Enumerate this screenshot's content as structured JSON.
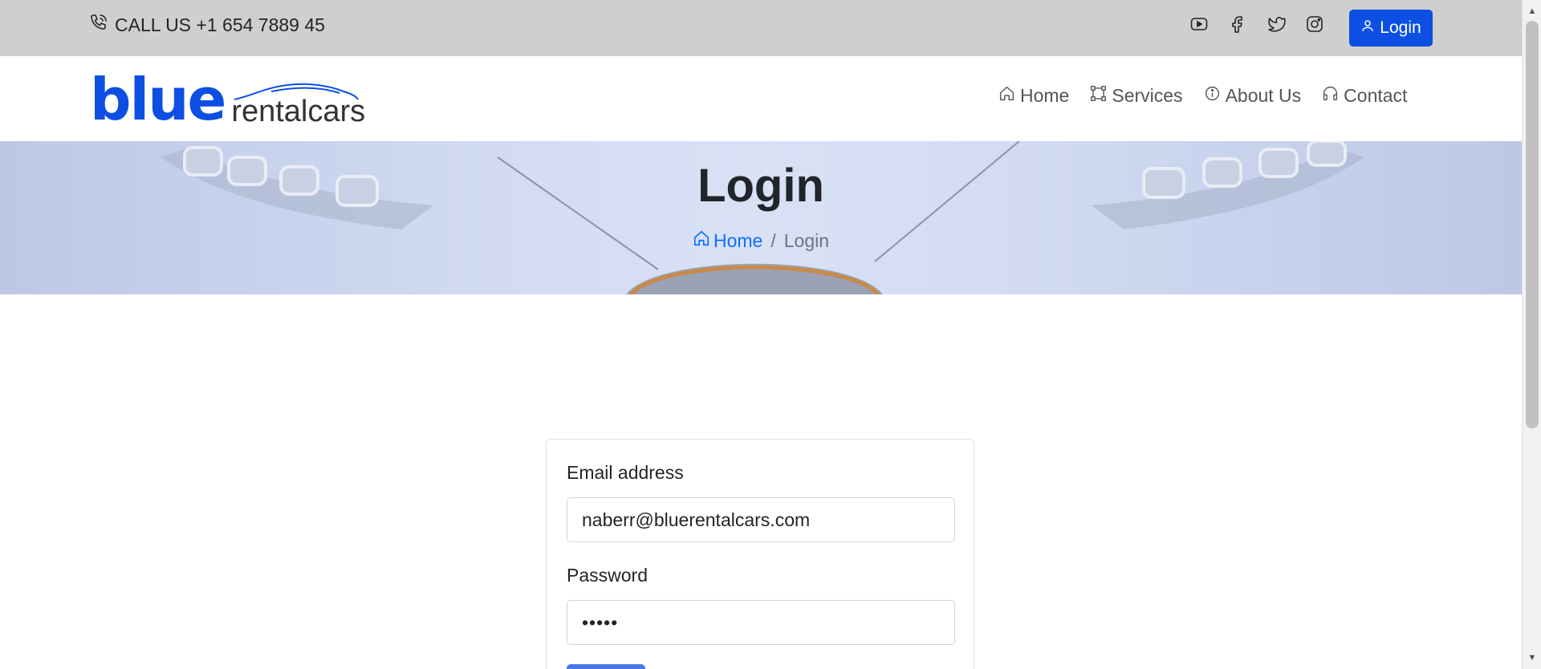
{
  "topbar": {
    "call_text": "CALL US +1 654 7889 45",
    "social_icons": [
      "youtube-icon",
      "facebook-icon",
      "twitter-icon",
      "instagram-icon"
    ],
    "login_label": "Login"
  },
  "header": {
    "logo_primary": "blue",
    "logo_secondary": "rentalcars",
    "nav": [
      {
        "label": "Home",
        "icon": "home-icon"
      },
      {
        "label": "Services",
        "icon": "bounding-box-icon"
      },
      {
        "label": "About Us",
        "icon": "info-circle-icon"
      },
      {
        "label": "Contact",
        "icon": "headphones-icon"
      }
    ]
  },
  "hero": {
    "title": "Login",
    "breadcrumb": {
      "home": "Home",
      "separator": "/",
      "current": "Login"
    }
  },
  "login_form": {
    "email_label": "Email address",
    "email_value": "naberr@bluerentalcars.com",
    "password_label": "Password",
    "password_value": "•••••"
  },
  "colors": {
    "brand_blue": "#0d4fe3",
    "topbar_bg": "#cfcfcf",
    "link_blue": "#0d6efd"
  }
}
